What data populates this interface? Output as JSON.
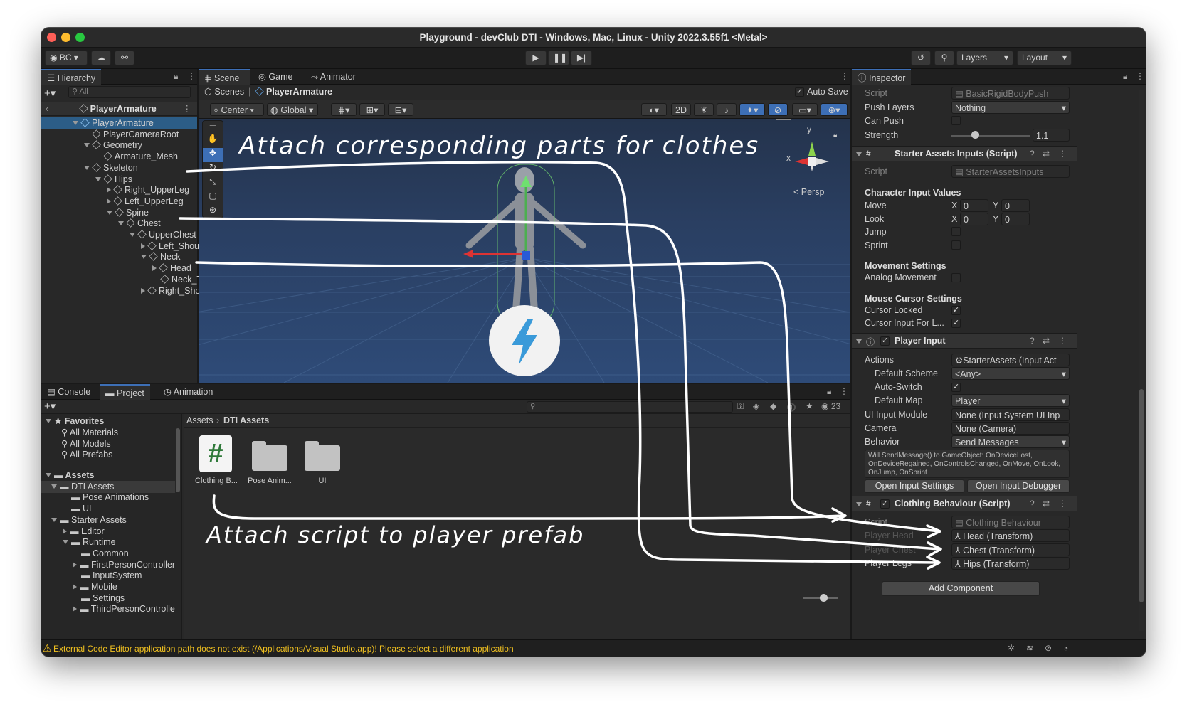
{
  "window": {
    "title": "Playground - devClub DTI - Windows, Mac, Linux - Unity 2022.3.55f1 <Metal>"
  },
  "toolbar": {
    "account": "BC",
    "layers": "Layers",
    "layout": "Layout"
  },
  "hierarchy": {
    "tab": "Hierarchy",
    "search_placeholder": "All",
    "scene_root": "PlayerArmature",
    "items": [
      {
        "label": "PlayerArmature"
      },
      {
        "label": "PlayerCameraRoot"
      },
      {
        "label": "Geometry"
      },
      {
        "label": "Armature_Mesh"
      },
      {
        "label": "Skeleton"
      },
      {
        "label": "Hips"
      },
      {
        "label": "Right_UpperLeg"
      },
      {
        "label": "Left_UpperLeg"
      },
      {
        "label": "Spine"
      },
      {
        "label": "Chest"
      },
      {
        "label": "UpperChest"
      },
      {
        "label": "Left_Should"
      },
      {
        "label": "Neck"
      },
      {
        "label": "Head"
      },
      {
        "label": "Neck_Tw"
      },
      {
        "label": "Right_Shoul"
      }
    ]
  },
  "scene": {
    "tabs": [
      "Scene",
      "Game",
      "Animator"
    ],
    "breadcrumb": [
      "Scenes",
      "PlayerArmature"
    ],
    "auto_save": "Auto Save",
    "pivot": "Center",
    "space": "Global",
    "mode_2d": "2D",
    "persp": "< Persp",
    "gizmo_x": "x",
    "gizmo_y": "y"
  },
  "bottom": {
    "tabs": [
      "Console",
      "Project",
      "Animation"
    ],
    "favorites": {
      "label": "Favorites",
      "items": [
        "All Materials",
        "All Models",
        "All Prefabs"
      ]
    },
    "assets_tree": [
      {
        "label": "Assets"
      },
      {
        "label": "DTI Assets"
      },
      {
        "label": "Pose Animations"
      },
      {
        "label": "UI"
      },
      {
        "label": "Starter Assets"
      },
      {
        "label": "Editor"
      },
      {
        "label": "Runtime"
      },
      {
        "label": "Common"
      },
      {
        "label": "FirstPersonController"
      },
      {
        "label": "InputSystem"
      },
      {
        "label": "Mobile"
      },
      {
        "label": "Settings"
      },
      {
        "label": "ThirdPersonControlle"
      }
    ],
    "breadcrumb": [
      "Assets",
      "DTI Assets"
    ],
    "count": "23",
    "files": [
      {
        "label": "Clothing B..."
      },
      {
        "label": "Pose Anim..."
      },
      {
        "label": "UI"
      }
    ]
  },
  "inspector": {
    "tab": "Inspector",
    "top": {
      "script_label": "Script",
      "script_value": "BasicRigidBodyPush",
      "push_layers_label": "Push Layers",
      "push_layers_value": "Nothing",
      "can_push_label": "Can Push",
      "strength_label": "Strength",
      "strength_value": "1.1",
      "strength_level": 0.3
    },
    "starter_inputs": {
      "title": "Starter Assets Inputs (Script)",
      "script_label": "Script",
      "script_value": "StarterAssetsInputs",
      "section1": "Character Input Values",
      "move_label": "Move",
      "look_label": "Look",
      "x_label": "X",
      "y_label": "Y",
      "move_x": "0",
      "move_y": "0",
      "look_x": "0",
      "look_y": "0",
      "jump_label": "Jump",
      "sprint_label": "Sprint",
      "section2": "Movement Settings",
      "analog_label": "Analog Movement",
      "section3": "Mouse Cursor Settings",
      "cursor_locked_label": "Cursor Locked",
      "cursor_input_label": "Cursor Input For L..."
    },
    "player_input": {
      "title": "Player Input",
      "actions_label": "Actions",
      "actions_value": "StarterAssets (Input Act",
      "scheme_label": "Default Scheme",
      "scheme_value": "<Any>",
      "autoswitch_label": "Auto-Switch",
      "map_label": "Default Map",
      "map_value": "Player",
      "ui_label": "UI Input Module",
      "ui_value": "None (Input System UI Inp",
      "camera_label": "Camera",
      "camera_value": "None (Camera)",
      "behavior_label": "Behavior",
      "behavior_value": "Send Messages",
      "info": "Will SendMessage() to GameObject: OnDeviceLost, OnDeviceRegained, OnControlsChanged, OnMove, OnLook, OnJump, OnSprint",
      "open_settings": "Open Input Settings",
      "open_debugger": "Open Input Debugger"
    },
    "clothing": {
      "title": "Clothing Behaviour (Script)",
      "script_label": "Script",
      "script_value": "Clothing Behaviour",
      "head_label": "Player Head",
      "head_value": "Head (Transform)",
      "chest_label": "Player Chest",
      "chest_value": "Chest (Transform)",
      "legs_label": "Player Legs",
      "legs_value": "Hips (Transform)"
    },
    "add_component": "Add Component"
  },
  "status": {
    "message": "External Code Editor application path does not exist (/Applications/Visual Studio.app)! Please select a different application"
  },
  "annotations": {
    "top": "Attach corresponding parts for clothes",
    "bottom": "Attach script to player prefab"
  }
}
